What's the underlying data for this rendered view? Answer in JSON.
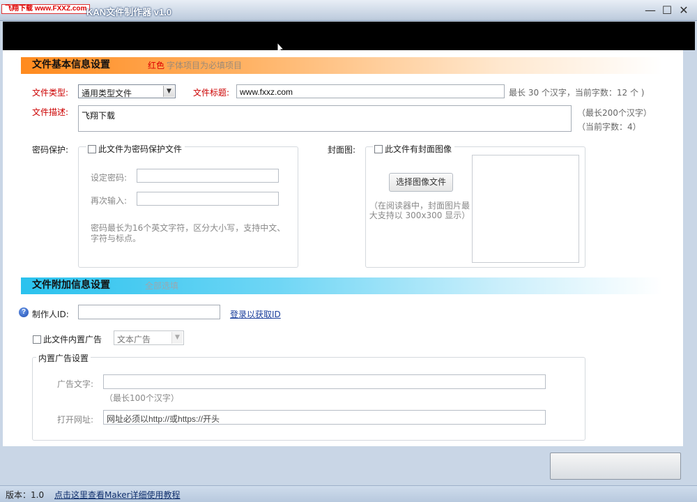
{
  "titlebar": {
    "watermark": "飞翔下载 www.FXXZ.com",
    "title": "KAN文件制作器 v1.0",
    "minimize_icon": "minimize-icon",
    "maximize_icon": "maximize-icon",
    "close_icon": "close-icon"
  },
  "basic": {
    "header": "文件基本信息设置",
    "note_red": "红色",
    "note_rest": "字体项目为必填项目",
    "type_label": "文件类型:",
    "type_value": "通用类型文件",
    "title_label": "文件标题:",
    "title_value": "www.fxxz.com",
    "title_hint": "最长 30 个汉字，当前字数：12 个 )",
    "desc_label": "文件描述:",
    "desc_value": "飞翔下载",
    "desc_hint1": "（最长200个汉字）",
    "desc_hint2": "（当前字数：4）"
  },
  "password": {
    "label": "密码保护:",
    "checkbox_label": "此文件为密码保护文件",
    "set_label": "设定密码:",
    "set_value": "",
    "repeat_label": "再次输入:",
    "repeat_value": "",
    "hint": "密码最长为16个英文字符，区分大小写，支持中文、字符与标点。"
  },
  "cover": {
    "label": "封面图:",
    "checkbox_label": "此文件有封面图像",
    "choose_button": "选择图像文件",
    "hint": "（在阅读器中，封面图片最大支持以 300x300 显示）"
  },
  "extra": {
    "header": "文件附加信息设置",
    "note": "全部选填",
    "creator_label": "制作人ID:",
    "creator_value": "",
    "login_link": "登录以获取ID",
    "ad_checkbox_label": "此文件内置广告",
    "ad_type_value": "文本广告",
    "ad_group_title": "内置广告设置",
    "ad_text_label": "广告文字:",
    "ad_text_value": "",
    "ad_text_hint": "（最长100个汉字）",
    "ad_url_label": "打开网址:",
    "ad_url_value": "网址必须以http://或https://开头"
  },
  "status": {
    "version": "版本：1.0",
    "help_link": "点击这里查看Maker详细使用教程"
  },
  "colors": {
    "required_red": "#cc0000",
    "basic_header": "#ff8a1e",
    "extra_header": "#2ac2ee",
    "link_blue": "#1a3e9c"
  }
}
